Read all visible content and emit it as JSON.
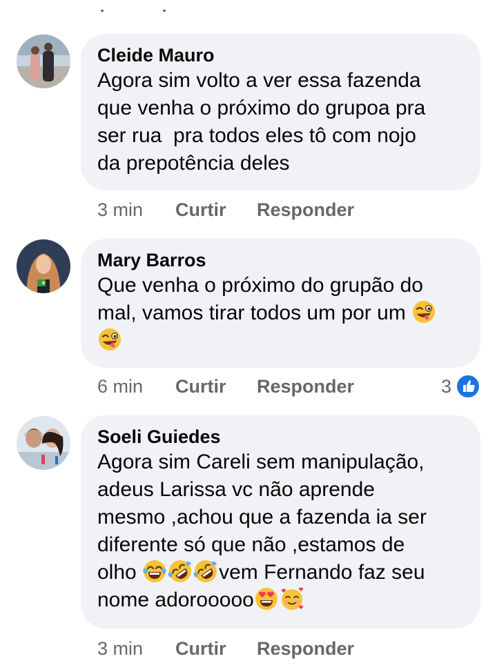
{
  "comments": [
    {
      "author": "Cleide Mauro",
      "lines": [
        "Agora sim volto a ver essa fazenda",
        "que venha o próximo do grupoa pra",
        "ser rua  pra todos eles tô com nojo",
        "da prepotência deles"
      ],
      "time": "3 min",
      "like_label": "Curtir",
      "reply_label": "Responder"
    },
    {
      "author": "Mary Barros",
      "lines": [
        "Que venha o próximo do grupão do",
        "mal, vamos tirar todos um por um"
      ],
      "time": "6 min",
      "like_label": "Curtir",
      "reply_label": "Responder",
      "reaction_count": "3"
    },
    {
      "author": "Soeli Guiedes",
      "lines": [
        "Agora sim Careli sem manipulação,",
        "adeus Larissa vc não aprende",
        "mesmo ,achou que a fazenda ia ser",
        "diferente só que não ,estamos de",
        "olho",
        "vem Fernando faz seu",
        "nome adorooooo"
      ],
      "time": "3 min",
      "like_label": "Curtir",
      "reply_label": "Responder"
    }
  ],
  "icons": {
    "emoji_wink": "winking-face-with-tongue",
    "emoji_tears": "face-with-tears-of-joy",
    "emoji_rofl": "rolling-on-the-floor-laughing",
    "emoji_heart_eyes": "smiling-face-with-heart-eyes",
    "emoji_hearts": "smiling-face-with-hearts",
    "reaction": "like-icon"
  },
  "colors": {
    "bubble": "#f0f2f5",
    "meta_text": "#65676b",
    "like_blue": "#1b74e4",
    "emoji_yellow": "#f7c23a"
  }
}
